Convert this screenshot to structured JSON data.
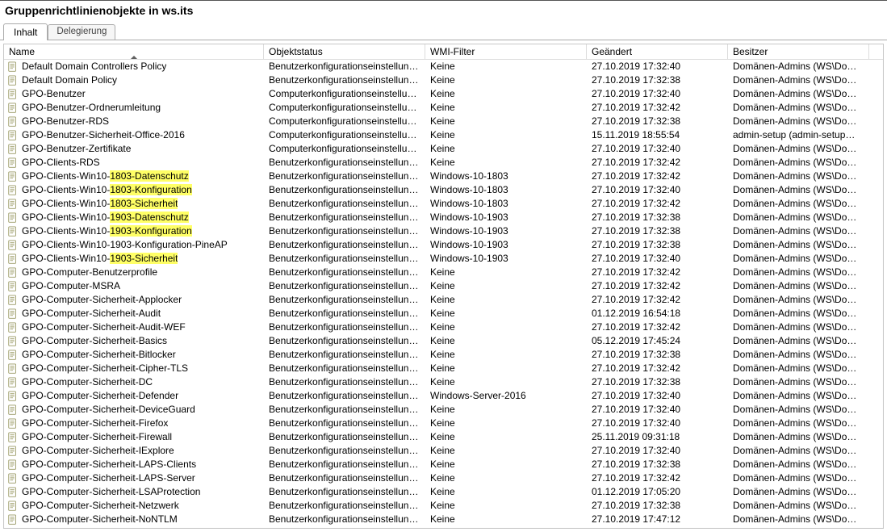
{
  "title": "Gruppenrichtlinienobjekte in ws.its",
  "tabs": {
    "content": "Inhalt",
    "delegation": "Delegierung"
  },
  "columns": {
    "name": "Name",
    "status": "Objektstatus",
    "wmi": "WMI-Filter",
    "modified": "Geändert",
    "owner": "Besitzer"
  },
  "owner_default": "Domänen-Admins (WS\\Domäne...",
  "owner_adminsetup": "admin-setup (admin-setup@ws.its)",
  "rows": [
    {
      "name": "Default Domain Controllers Policy",
      "status": "Benutzerkonfigurationseinstellungen d...",
      "wmi": "Keine",
      "mod": "27.10.2019 17:32:40",
      "owner": "def",
      "hl": null
    },
    {
      "name": "Default Domain Policy",
      "status": "Benutzerkonfigurationseinstellungen d...",
      "wmi": "Keine",
      "mod": "27.10.2019 17:32:38",
      "owner": "def",
      "hl": null
    },
    {
      "name": "GPO-Benutzer",
      "status": "Computerkonfigurationseinstellungen d...",
      "wmi": "Keine",
      "mod": "27.10.2019 17:32:40",
      "owner": "def",
      "hl": null
    },
    {
      "name": "GPO-Benutzer-Ordnerumleitung",
      "status": "Computerkonfigurationseinstellungen d...",
      "wmi": "Keine",
      "mod": "27.10.2019 17:32:42",
      "owner": "def",
      "hl": null
    },
    {
      "name": "GPO-Benutzer-RDS",
      "status": "Computerkonfigurationseinstellungen d...",
      "wmi": "Keine",
      "mod": "27.10.2019 17:32:38",
      "owner": "def",
      "hl": null
    },
    {
      "name": "GPO-Benutzer-Sicherheit-Office-2016",
      "status": "Computerkonfigurationseinstellungen d...",
      "wmi": "Keine",
      "mod": "15.11.2019 18:55:54",
      "owner": "adm",
      "hl": null
    },
    {
      "name": "GPO-Benutzer-Zertifikate",
      "status": "Computerkonfigurationseinstellungen d...",
      "wmi": "Keine",
      "mod": "27.10.2019 17:32:40",
      "owner": "def",
      "hl": null
    },
    {
      "name": "GPO-Clients-RDS",
      "status": "Benutzerkonfigurationseinstellungen d...",
      "wmi": "Keine",
      "mod": "27.10.2019 17:32:42",
      "owner": "def",
      "hl": null
    },
    {
      "name": "GPO-Clients-Win10-1803-Datenschutz",
      "status": "Benutzerkonfigurationseinstellungen d...",
      "wmi": "Windows-10-1803",
      "mod": "27.10.2019 17:32:42",
      "owner": "def",
      "hl": [
        18,
        35
      ]
    },
    {
      "name": "GPO-Clients-Win10-1803-Konfiguration",
      "status": "Benutzerkonfigurationseinstellungen d...",
      "wmi": "Windows-10-1803",
      "mod": "27.10.2019 17:32:40",
      "owner": "def",
      "hl": [
        18,
        37
      ]
    },
    {
      "name": "GPO-Clients-Win10-1803-Sicherheit",
      "status": "Benutzerkonfigurationseinstellungen d...",
      "wmi": "Windows-10-1803",
      "mod": "27.10.2019 17:32:42",
      "owner": "def",
      "hl": [
        18,
        34
      ]
    },
    {
      "name": "GPO-Clients-Win10-1903-Datenschutz",
      "status": "Benutzerkonfigurationseinstellungen d...",
      "wmi": "Windows-10-1903",
      "mod": "27.10.2019 17:32:38",
      "owner": "def",
      "hl": [
        18,
        35
      ]
    },
    {
      "name": "GPO-Clients-Win10-1903-Konfiguration",
      "status": "Benutzerkonfigurationseinstellungen d...",
      "wmi": "Windows-10-1903",
      "mod": "27.10.2019 17:32:38",
      "owner": "def",
      "hl": [
        18,
        37
      ]
    },
    {
      "name": "GPO-Clients-Win10-1903-Konfiguration-PineAP",
      "status": "Benutzerkonfigurationseinstellungen d...",
      "wmi": "Windows-10-1903",
      "mod": "27.10.2019 17:32:38",
      "owner": "def",
      "hl": null
    },
    {
      "name": "GPO-Clients-Win10-1903-Sicherheit",
      "status": "Benutzerkonfigurationseinstellungen d...",
      "wmi": "Windows-10-1903",
      "mod": "27.10.2019 17:32:40",
      "owner": "def",
      "hl": [
        18,
        34
      ]
    },
    {
      "name": "GPO-Computer-Benutzerprofile",
      "status": "Benutzerkonfigurationseinstellungen d...",
      "wmi": "Keine",
      "mod": "27.10.2019 17:32:42",
      "owner": "def",
      "hl": null
    },
    {
      "name": "GPO-Computer-MSRA",
      "status": "Benutzerkonfigurationseinstellungen d...",
      "wmi": "Keine",
      "mod": "27.10.2019 17:32:42",
      "owner": "def",
      "hl": null
    },
    {
      "name": "GPO-Computer-Sicherheit-Applocker",
      "status": "Benutzerkonfigurationseinstellungen d...",
      "wmi": "Keine",
      "mod": "27.10.2019 17:32:42",
      "owner": "def",
      "hl": null
    },
    {
      "name": "GPO-Computer-Sicherheit-Audit",
      "status": "Benutzerkonfigurationseinstellungen d...",
      "wmi": "Keine",
      "mod": "01.12.2019 16:54:18",
      "owner": "def",
      "hl": null
    },
    {
      "name": "GPO-Computer-Sicherheit-Audit-WEF",
      "status": "Benutzerkonfigurationseinstellungen d...",
      "wmi": "Keine",
      "mod": "27.10.2019 17:32:42",
      "owner": "def",
      "hl": null
    },
    {
      "name": "GPO-Computer-Sicherheit-Basics",
      "status": "Benutzerkonfigurationseinstellungen d...",
      "wmi": "Keine",
      "mod": "05.12.2019 17:45:24",
      "owner": "def",
      "hl": null
    },
    {
      "name": "GPO-Computer-Sicherheit-Bitlocker",
      "status": "Benutzerkonfigurationseinstellungen d...",
      "wmi": "Keine",
      "mod": "27.10.2019 17:32:38",
      "owner": "def",
      "hl": null
    },
    {
      "name": "GPO-Computer-Sicherheit-Cipher-TLS",
      "status": "Benutzerkonfigurationseinstellungen d...",
      "wmi": "Keine",
      "mod": "27.10.2019 17:32:42",
      "owner": "def",
      "hl": null
    },
    {
      "name": "GPO-Computer-Sicherheit-DC",
      "status": "Benutzerkonfigurationseinstellungen d...",
      "wmi": "Keine",
      "mod": "27.10.2019 17:32:38",
      "owner": "def",
      "hl": null
    },
    {
      "name": "GPO-Computer-Sicherheit-Defender",
      "status": "Benutzerkonfigurationseinstellungen d...",
      "wmi": "Windows-Server-2016",
      "mod": "27.10.2019 17:32:40",
      "owner": "def",
      "hl": null
    },
    {
      "name": "GPO-Computer-Sicherheit-DeviceGuard",
      "status": "Benutzerkonfigurationseinstellungen d...",
      "wmi": "Keine",
      "mod": "27.10.2019 17:32:40",
      "owner": "def",
      "hl": null
    },
    {
      "name": "GPO-Computer-Sicherheit-Firefox",
      "status": "Benutzerkonfigurationseinstellungen d...",
      "wmi": "Keine",
      "mod": "27.10.2019 17:32:40",
      "owner": "def",
      "hl": null
    },
    {
      "name": "GPO-Computer-Sicherheit-Firewall",
      "status": "Benutzerkonfigurationseinstellungen d...",
      "wmi": "Keine",
      "mod": "25.11.2019 09:31:18",
      "owner": "def",
      "hl": null
    },
    {
      "name": "GPO-Computer-Sicherheit-IExplore",
      "status": "Benutzerkonfigurationseinstellungen d...",
      "wmi": "Keine",
      "mod": "27.10.2019 17:32:40",
      "owner": "def",
      "hl": null
    },
    {
      "name": "GPO-Computer-Sicherheit-LAPS-Clients",
      "status": "Benutzerkonfigurationseinstellungen d...",
      "wmi": "Keine",
      "mod": "27.10.2019 17:32:38",
      "owner": "def",
      "hl": null
    },
    {
      "name": "GPO-Computer-Sicherheit-LAPS-Server",
      "status": "Benutzerkonfigurationseinstellungen d...",
      "wmi": "Keine",
      "mod": "27.10.2019 17:32:42",
      "owner": "def",
      "hl": null
    },
    {
      "name": "GPO-Computer-Sicherheit-LSAProtection",
      "status": "Benutzerkonfigurationseinstellungen d...",
      "wmi": "Keine",
      "mod": "01.12.2019 17:05:20",
      "owner": "def",
      "hl": null
    },
    {
      "name": "GPO-Computer-Sicherheit-Netzwerk",
      "status": "Benutzerkonfigurationseinstellungen d...",
      "wmi": "Keine",
      "mod": "27.10.2019 17:32:38",
      "owner": "def",
      "hl": null
    },
    {
      "name": "GPO-Computer-Sicherheit-NoNTLM",
      "status": "Benutzerkonfigurationseinstellungen d...",
      "wmi": "Keine",
      "mod": "27.10.2019 17:47:12",
      "owner": "def",
      "hl": null
    }
  ]
}
